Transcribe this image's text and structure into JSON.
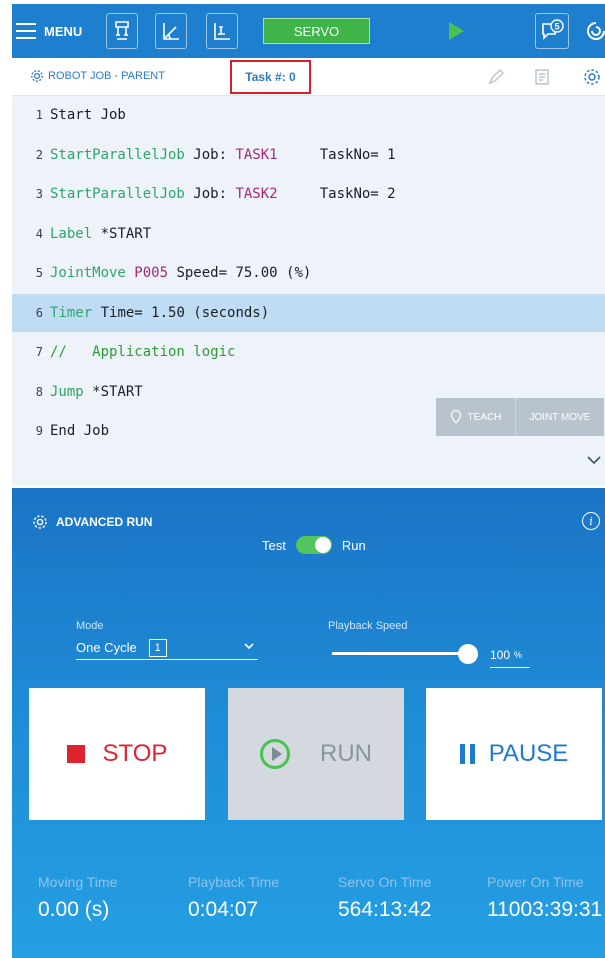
{
  "topbar": {
    "menu_label": "MENU",
    "servo_label": "SERVO",
    "message_count": "5"
  },
  "subheader": {
    "job_title": "ROBOT JOB - PARENT",
    "task_label": "Task #: 0"
  },
  "editor": {
    "lines": [
      {
        "num": "1",
        "tokens": [
          [
            "t",
            "Start Job"
          ]
        ]
      },
      {
        "num": "2",
        "tokens": [
          [
            "kw",
            "StartParallelJob"
          ],
          [
            "t",
            " Job: "
          ],
          [
            "mg",
            "TASK1"
          ],
          [
            "t",
            "     TaskNo= 1"
          ]
        ]
      },
      {
        "num": "3",
        "tokens": [
          [
            "kw",
            "StartParallelJob"
          ],
          [
            "t",
            " Job: "
          ],
          [
            "mg",
            "TASK2"
          ],
          [
            "t",
            "     TaskNo= 2"
          ]
        ]
      },
      {
        "num": "4",
        "tokens": [
          [
            "kw",
            "Label"
          ],
          [
            "t",
            " *START"
          ]
        ]
      },
      {
        "num": "5",
        "tokens": [
          [
            "kw",
            "JointMove"
          ],
          [
            "t",
            " "
          ],
          [
            "mg",
            "P005"
          ],
          [
            "t",
            " Speed= 75.00 (%)"
          ]
        ]
      },
      {
        "num": "6",
        "tokens": [
          [
            "kw",
            "Timer"
          ],
          [
            "t",
            " Time= 1.50 (seconds)"
          ]
        ],
        "selected": true
      },
      {
        "num": "7",
        "tokens": [
          [
            "cm",
            "//   Application logic"
          ]
        ]
      },
      {
        "num": "8",
        "tokens": [
          [
            "kw",
            "Jump"
          ],
          [
            "t",
            " *START"
          ]
        ]
      },
      {
        "num": "9",
        "tokens": [
          [
            "t",
            "End Job"
          ]
        ]
      }
    ],
    "teach_label": "TEACH",
    "joint_move_label": "JOINT MOVE"
  },
  "advanced_run": {
    "title": "ADVANCED RUN",
    "toggle_left": "Test",
    "toggle_right": "Run",
    "mode_label": "Mode",
    "mode_value": "One Cycle",
    "mode_number": "1",
    "speed_label": "Playback Speed",
    "speed_value": "100",
    "speed_unit": "%",
    "speed_fraction": 1.0,
    "stop_label": "STOP",
    "run_label": "RUN",
    "pause_label": "PAUSE",
    "stats": [
      {
        "label": "Moving Time",
        "value": "0.00 (s)"
      },
      {
        "label": "Playback Time",
        "value": "0:04:07"
      },
      {
        "label": "Servo On Time",
        "value": "564:13:42"
      },
      {
        "label": "Power On Time",
        "value": "11003:39:31"
      }
    ]
  },
  "colors": {
    "topbar": "#1e7fcf",
    "servo": "#3fb549",
    "stop": "#e0242f",
    "keyword": "#2fa56a",
    "variable": "#a5287b"
  }
}
